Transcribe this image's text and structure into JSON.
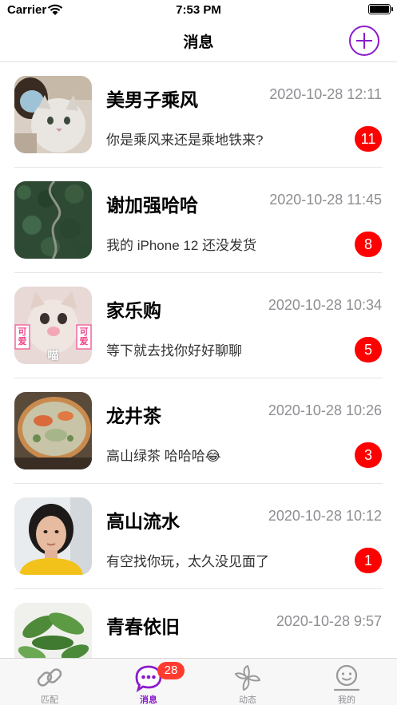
{
  "status_bar": {
    "carrier": "Carrier",
    "time": "7:53 PM"
  },
  "nav": {
    "title": "消息",
    "add_icon": "plus-circle-icon",
    "accent_color": "#8b1bc9"
  },
  "chats": [
    {
      "name": "美男子乘风",
      "time": "2020-10-28 12:11",
      "preview": "你是乘风来还是乘地铁来?",
      "unread": "11",
      "avatar": "avatar-masked-person-with-cat"
    },
    {
      "name": "谢加强哈哈",
      "time": "2020-10-28 11:45",
      "preview": "我的 iPhone 12 还没发货",
      "unread": "8",
      "avatar": "avatar-aerial-forest-road"
    },
    {
      "name": "家乐购",
      "time": "2020-10-28 10:34",
      "preview": "等下就去找你好好聊聊",
      "unread": "5",
      "avatar": "avatar-cute-cat-sticker",
      "avatar_text": {
        "left": "可爱",
        "right": "可爱",
        "bottom": "喵"
      }
    },
    {
      "name": "龙井茶",
      "time": "2020-10-28 10:26",
      "preview": "高山绿茶 哈哈哈",
      "preview_emoji": "😂",
      "unread": "3",
      "avatar": "avatar-soup-bowl"
    },
    {
      "name": "高山流水",
      "time": "2020-10-28 10:12",
      "preview": "有空找你玩，太久没见面了",
      "unread": "1",
      "avatar": "avatar-woman-portrait"
    },
    {
      "name": "青春依旧",
      "time": "2020-10-28 9:57",
      "preview": "",
      "unread": "",
      "avatar": "avatar-green-plant"
    }
  ],
  "tabs": [
    {
      "label": "匹配",
      "icon": "link-icon"
    },
    {
      "label": "消息",
      "icon": "chat-bubble-icon",
      "badge": "28",
      "active": true
    },
    {
      "label": "动态",
      "icon": "pinwheel-icon"
    },
    {
      "label": "我的",
      "icon": "smiley-face-icon"
    }
  ],
  "colors": {
    "badge": "#ff0000",
    "tab_badge": "#ff3b30",
    "active_tab": "#8b1bc9",
    "inactive_tab": "#8e8e93"
  }
}
